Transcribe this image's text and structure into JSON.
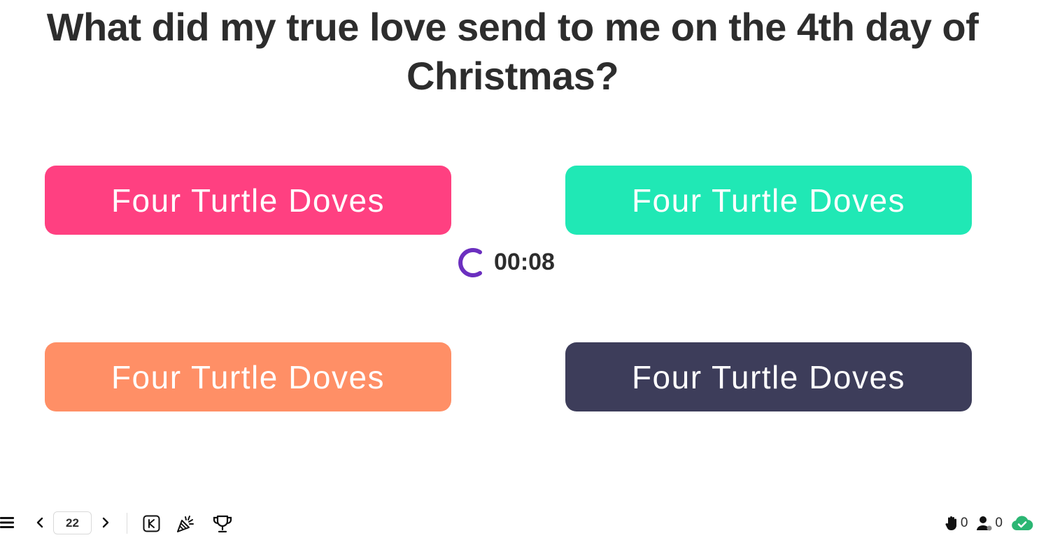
{
  "question": {
    "text": "What did my true love send to me on the 4th day of Christmas?"
  },
  "answers": [
    {
      "label": "Four Turtle Doves",
      "color": "#ff4081"
    },
    {
      "label": "Four Turtle Doves",
      "color": "#20e8b5"
    },
    {
      "label": "Four Turtle Doves",
      "color": "#ff8f66"
    },
    {
      "label": "Four Turtle Doves",
      "color": "#3d3d5a"
    }
  ],
  "timer": {
    "text": "00:08",
    "spinner_color": "#6b2fbf",
    "icon": "spinner-icon"
  },
  "toolbar": {
    "menu_icon": "menu-icon",
    "prev_icon": "chevron-left-icon",
    "page_number": "22",
    "next_icon": "chevron-right-icon",
    "keyboard_icon": "keyboard-k-icon",
    "celebrate_icon": "party-popper-icon",
    "leaderboard_icon": "trophy-icon"
  },
  "status": {
    "hands_raised": "0",
    "participants": "0",
    "hand_icon": "raised-hand-icon",
    "user_icon": "user-icon",
    "cloud_icon": "cloud-check-icon",
    "connected_color": "#2bb673"
  }
}
